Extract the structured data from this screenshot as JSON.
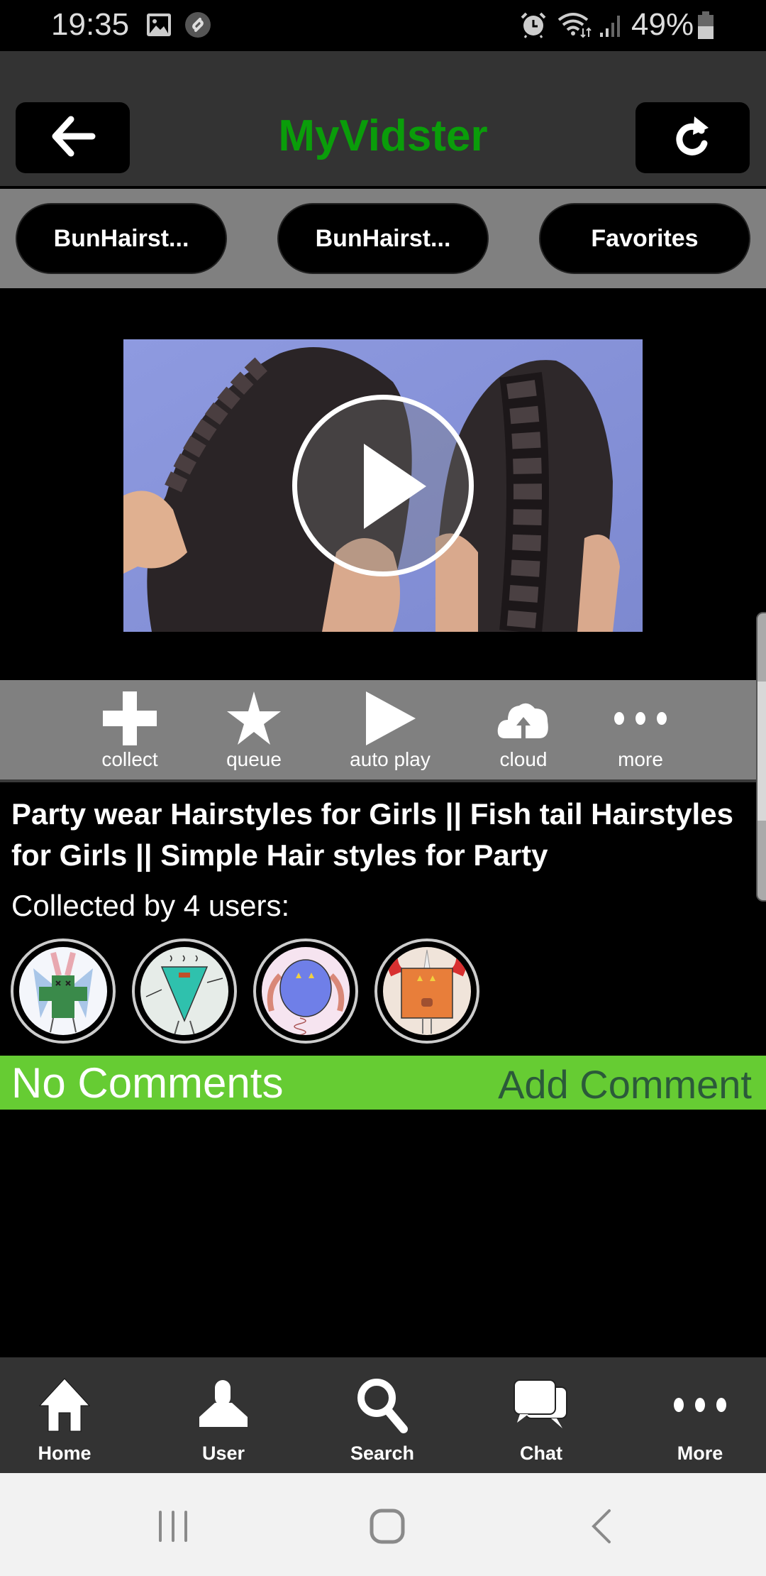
{
  "status_bar": {
    "time": "19:35",
    "left_icons": [
      "gallery-icon",
      "shazam-icon"
    ],
    "right_icons": [
      "alarm-icon",
      "wifi-icon",
      "signal-icon",
      "battery-icon"
    ],
    "battery_percent": "49%"
  },
  "header": {
    "title": "MyVidster",
    "title_color": "#0a9d0a",
    "back_icon": "arrow-left-icon",
    "refresh_icon": "refresh-icon"
  },
  "tabs": [
    {
      "label": "BunHairst..."
    },
    {
      "label": "BunHairst..."
    },
    {
      "label": "Favorites"
    }
  ],
  "video": {
    "thumbnail": "braided-hairstyles-thumbnail",
    "play_icon": "play-circle-icon"
  },
  "actions": [
    {
      "icon": "plus-icon",
      "label": "collect"
    },
    {
      "icon": "star-icon",
      "label": "queue"
    },
    {
      "icon": "play-icon",
      "label": "auto play"
    },
    {
      "icon": "cloud-upload-icon",
      "label": "cloud"
    },
    {
      "icon": "ellipsis-icon",
      "label": "more"
    }
  ],
  "details": {
    "title": "Party wear Hairstyles for Girls || Fish tail Hairstyles for Girls || Simple Hair styles for Party",
    "collected_by": "Collected by 4 users:",
    "collectors": [
      {
        "avatar": "green-bunny-monster-avatar"
      },
      {
        "avatar": "teal-triangle-monster-avatar"
      },
      {
        "avatar": "blue-round-monster-avatar"
      },
      {
        "avatar": "orange-square-crab-monster-avatar"
      }
    ]
  },
  "comments": {
    "status": "No Comments",
    "add_label": "Add Comment",
    "bar_color": "#66cc33"
  },
  "bottom_nav": [
    {
      "icon": "home-icon",
      "label": "Home"
    },
    {
      "icon": "user-icon",
      "label": "User"
    },
    {
      "icon": "search-icon",
      "label": "Search"
    },
    {
      "icon": "chat-icon",
      "label": "Chat"
    },
    {
      "icon": "more-icon",
      "label": "More"
    }
  ],
  "system_nav": [
    "recents-icon",
    "home-button-icon",
    "back-icon"
  ]
}
